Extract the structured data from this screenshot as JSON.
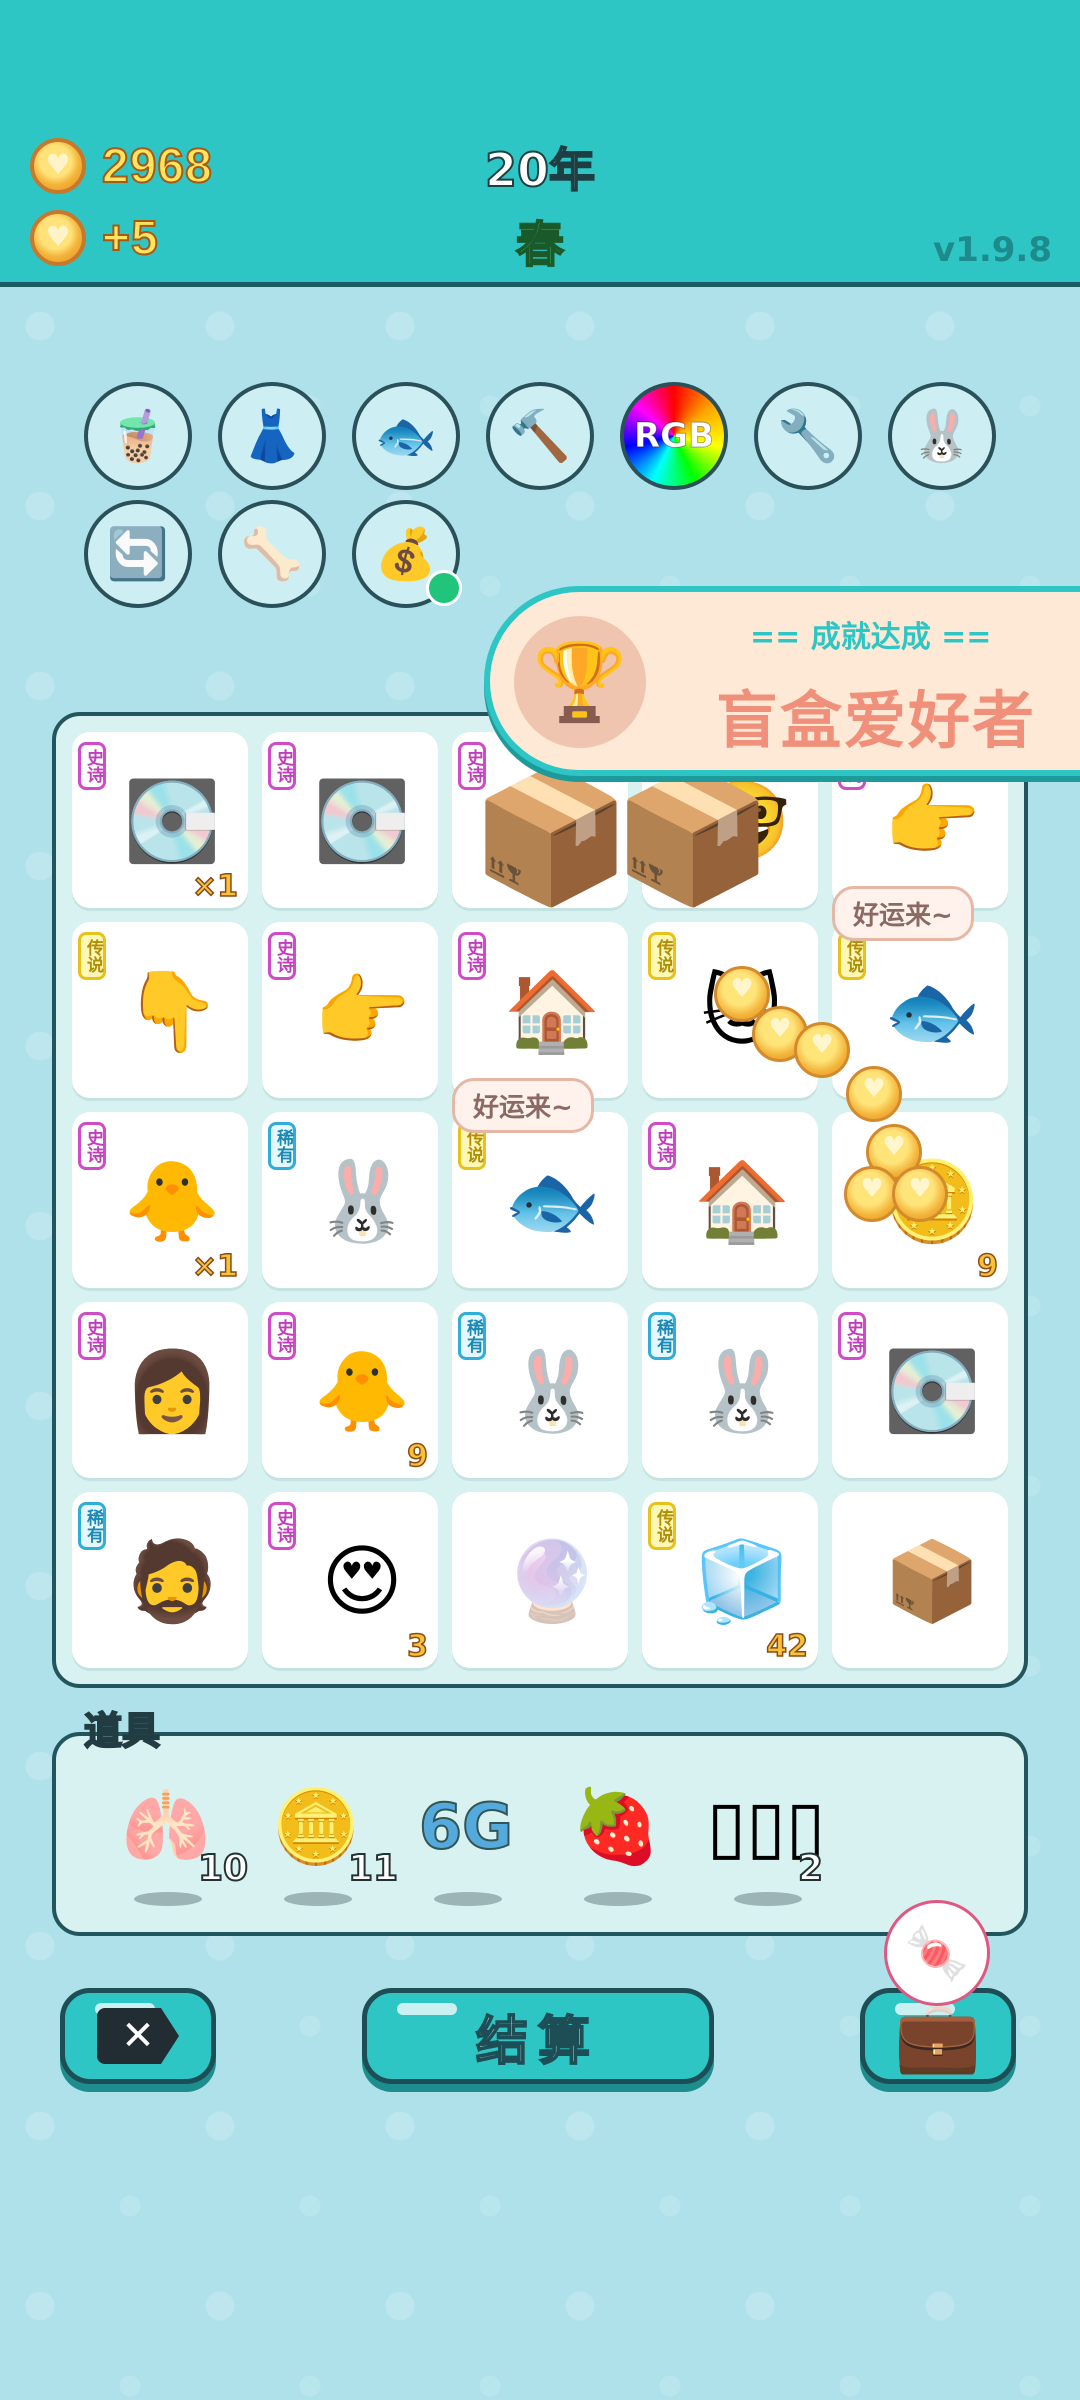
{
  "header": {
    "coins": "2968",
    "income": "+5",
    "year": "20年",
    "season": "春",
    "version": "v1.9.8",
    "colors": {
      "bar": "#2ec6c5",
      "coin_text": "#ffe45f",
      "season": "#47e06b"
    }
  },
  "top_icons": [
    {
      "icon": "bubble-tea-icon",
      "glyph": "🧋"
    },
    {
      "icon": "skirt-icon",
      "glyph": "👗"
    },
    {
      "icon": "fish-tank-icon",
      "glyph": "🐟"
    },
    {
      "icon": "hammer-icon",
      "glyph": "🔨"
    },
    {
      "icon": "rgb-icon",
      "glyph": "RGB"
    },
    {
      "icon": "air-pump-icon",
      "glyph": "🔧"
    },
    {
      "icon": "rabbit-icon",
      "glyph": "🐰"
    },
    {
      "icon": "refresh-icon",
      "glyph": "🔄"
    },
    {
      "icon": "pet-food-bowl-icon",
      "glyph": "🦴"
    },
    {
      "icon": "sack-icon",
      "glyph": "💰"
    }
  ],
  "achievement": {
    "header": "== 成就达成 ==",
    "title": "盲盒爱好者",
    "icon": "trophy-icon",
    "glyph": "🏆"
  },
  "speech_bubbles": [
    "好运来~",
    "好运来~"
  ],
  "board": {
    "rows": [
      [
        {
          "name": "graphics-card",
          "rarity": "史诗",
          "tier": "epic",
          "glyph": "💽",
          "count": "×1"
        },
        {
          "name": "graphics-card",
          "rarity": "史诗",
          "tier": "epic",
          "glyph": "💽",
          "count": ""
        },
        {
          "name": "cardboard-box",
          "rarity": "史诗",
          "tier": "epic",
          "glyph": "",
          "count": ""
        },
        {
          "name": "nerd-face",
          "rarity": "",
          "tier": "",
          "glyph": "🤓",
          "count": ""
        },
        {
          "name": "pointing-hand",
          "rarity": "史诗",
          "tier": "epic",
          "glyph": "👉",
          "count": ""
        }
      ],
      [
        {
          "name": "pointing-down-hand",
          "rarity": "传说",
          "tier": "legend",
          "glyph": "👇",
          "count": ""
        },
        {
          "name": "pointing-hand",
          "rarity": "史诗",
          "tier": "epic",
          "glyph": "👉",
          "count": ""
        },
        {
          "name": "rabbit-house",
          "rarity": "史诗",
          "tier": "epic",
          "glyph": "🏠",
          "count": ""
        },
        {
          "name": "crowned-cat",
          "rarity": "传说",
          "tier": "legend",
          "glyph": "🐱",
          "count": ""
        },
        {
          "name": "koi-fish",
          "rarity": "传说",
          "tier": "legend",
          "glyph": "🐟",
          "count": ""
        }
      ],
      [
        {
          "name": "chick-face",
          "rarity": "史诗",
          "tier": "epic",
          "glyph": "🐥",
          "count": "×1"
        },
        {
          "name": "rabbit",
          "rarity": "稀有",
          "tier": "rare",
          "glyph": "🐰",
          "count": ""
        },
        {
          "name": "koi-fish",
          "rarity": "传说",
          "tier": "legend",
          "glyph": "🐟",
          "count": ""
        },
        {
          "name": "rabbit-house",
          "rarity": "史诗",
          "tier": "epic",
          "glyph": "🏠",
          "count": ""
        },
        {
          "name": "coin-pot",
          "rarity": "",
          "tier": "",
          "glyph": "🪙",
          "count": "9"
        }
      ],
      [
        {
          "name": "girl-face",
          "rarity": "史诗",
          "tier": "epic",
          "glyph": "👩",
          "count": ""
        },
        {
          "name": "chick-face",
          "rarity": "史诗",
          "tier": "epic",
          "glyph": "🐥",
          "count": "9"
        },
        {
          "name": "rabbit",
          "rarity": "稀有",
          "tier": "rare",
          "glyph": "🐰",
          "count": ""
        },
        {
          "name": "rabbit",
          "rarity": "稀有",
          "tier": "rare",
          "glyph": "🐰",
          "count": ""
        },
        {
          "name": "graphics-card",
          "rarity": "史诗",
          "tier": "epic",
          "glyph": "💽",
          "count": ""
        }
      ],
      [
        {
          "name": "hat-man-face",
          "rarity": "稀有",
          "tier": "rare",
          "glyph": "🧔",
          "count": ""
        },
        {
          "name": "heart-eyes-chick",
          "rarity": "史诗",
          "tier": "epic",
          "glyph": "😍",
          "count": "3"
        },
        {
          "name": "glass-ball",
          "rarity": "",
          "tier": "",
          "glyph": "🔮",
          "count": "",
          "faded": true
        },
        {
          "name": "fridge",
          "rarity": "传说",
          "tier": "legend",
          "glyph": "🧊",
          "count": "42"
        },
        {
          "name": "cardboard-box",
          "rarity": "",
          "tier": "",
          "glyph": "📦",
          "count": ""
        }
      ]
    ]
  },
  "items": {
    "label": "道具",
    "list": [
      {
        "name": "liver-icon",
        "glyph": "🫁",
        "qty": "10"
      },
      {
        "name": "dollar-coin-icon",
        "glyph": "🪙",
        "qty": "11"
      },
      {
        "name": "6g-icon",
        "glyph": "6G",
        "qty": ""
      },
      {
        "name": "strawberry-icon",
        "glyph": "🍓",
        "qty": ""
      },
      {
        "name": "battery-cells-icon",
        "glyph": "▯▯▯",
        "qty": "2"
      }
    ]
  },
  "buttons": {
    "close": "✕",
    "settle": "结算",
    "bag": "💼"
  }
}
